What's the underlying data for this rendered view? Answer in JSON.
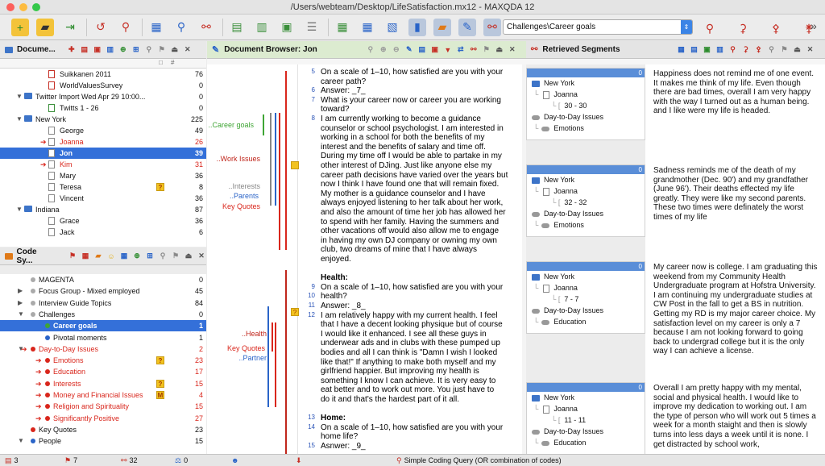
{
  "window": {
    "title": "/Users/webteam/Desktop/LifeSatisfaction.mx12 - MAXQDA 12"
  },
  "toolbar": {
    "code_selector": "Challenges\\Career goals",
    "more": "»"
  },
  "doc_system": {
    "title": "Docume...",
    "col_icons": [
      "□",
      "#"
    ],
    "rows": [
      {
        "label": "Suikkanen 2011",
        "num": "76",
        "type": "pdf",
        "indent": 60
      },
      {
        "label": "WorldValuesSurvey",
        "num": "0",
        "type": "pdf",
        "indent": 60
      },
      {
        "label": "Twitter Import Wed Apr 29 10:00...",
        "num": "0",
        "type": "folder",
        "indent": 30
      },
      {
        "label": "Twitts 1 - 26",
        "num": "0",
        "type": "table",
        "indent": 60
      },
      {
        "label": "New York",
        "num": "225",
        "type": "folder",
        "indent": 30
      },
      {
        "label": "George",
        "num": "49",
        "type": "doc",
        "indent": 60
      },
      {
        "label": "Joanna",
        "num": "26",
        "type": "doc",
        "indent": 60,
        "red": true
      },
      {
        "label": "Jon",
        "num": "39",
        "type": "doc",
        "indent": 60,
        "sel": true
      },
      {
        "label": "Kim",
        "num": "31",
        "type": "doc",
        "indent": 60,
        "red": true
      },
      {
        "label": "Mary",
        "num": "36",
        "type": "doc",
        "indent": 60
      },
      {
        "label": "Teresa",
        "num": "8",
        "type": "doc",
        "indent": 60,
        "memo": "?"
      },
      {
        "label": "Vincent",
        "num": "36",
        "type": "doc",
        "indent": 60
      },
      {
        "label": "Indiana",
        "num": "87",
        "type": "folder",
        "indent": 30
      },
      {
        "label": "Grace",
        "num": "36",
        "type": "doc",
        "indent": 60
      },
      {
        "label": "Jack",
        "num": "6",
        "type": "doc",
        "indent": 60
      }
    ]
  },
  "code_system": {
    "title": "Code Sy...",
    "rows": [
      {
        "label": "MAGENTA",
        "num": "0",
        "color": "#aaaaaa",
        "indent": 38
      },
      {
        "label": "Focus Group - Mixed employed",
        "num": "45",
        "color": "#aaaaaa",
        "indent": 38,
        "tri": "▶"
      },
      {
        "label": "Interview Guide Topics",
        "num": "84",
        "color": "#aaaaaa",
        "indent": 38,
        "tri": "▶"
      },
      {
        "label": "Challenges",
        "num": "0",
        "color": "#aaaaaa",
        "indent": 38,
        "tri": "▼"
      },
      {
        "label": "Career goals",
        "num": "1",
        "color": "#3fa535",
        "indent": 56,
        "sel": true
      },
      {
        "label": "Pivotal moments",
        "num": "1",
        "color": "#2a64c8",
        "indent": 56
      },
      {
        "label": "Day-to-Day Issues",
        "num": "2",
        "color": "#d9261c",
        "indent": 38,
        "tri": "▼",
        "red": true
      },
      {
        "label": "Emotions",
        "num": "23",
        "color": "#d9261c",
        "indent": 56,
        "red": true,
        "memo": "?"
      },
      {
        "label": "Education",
        "num": "17",
        "color": "#d9261c",
        "indent": 56,
        "red": true
      },
      {
        "label": "Interests",
        "num": "15",
        "color": "#d9261c",
        "indent": 56,
        "red": true,
        "memo": "?"
      },
      {
        "label": "Money and Financial Issues",
        "num": "4",
        "color": "#d9261c",
        "indent": 56,
        "red": true,
        "memo": "M"
      },
      {
        "label": "Religion and Spirituality",
        "num": "15",
        "color": "#d9261c",
        "indent": 56,
        "red": true
      },
      {
        "label": "Significantly Positive",
        "num": "27",
        "color": "#d9261c",
        "indent": 56,
        "red": true
      },
      {
        "label": "Key Quotes",
        "num": "23",
        "color": "#d9261c",
        "indent": 38
      },
      {
        "label": "People",
        "num": "15",
        "color": "#2a64c8",
        "indent": 38,
        "tri": "▼"
      }
    ]
  },
  "doc_browser": {
    "title": "Document Browser: Jon",
    "code_labels": [
      {
        "text": "..Career goals",
        "color": "#3fa535"
      },
      {
        "text": "..Work Issues",
        "color": "#c0261c"
      },
      {
        "text": "..Interests",
        "color": "#888888"
      },
      {
        "text": "..Parents",
        "color": "#2a64c8"
      },
      {
        "text": "Key Quotes",
        "color": "#d9261c"
      },
      {
        "text": "..Health",
        "color": "#c0261c"
      },
      {
        "text": "Key Quotes",
        "color": "#d9261c"
      },
      {
        "text": "..Partner",
        "color": "#2a64c8"
      }
    ],
    "line_numbers": [
      "5",
      "6",
      "7",
      "8",
      "9",
      "10",
      "11",
      "12",
      "13",
      "14",
      "15"
    ],
    "lines": [
      "On a scale of 1–10, how satisfied are you with your",
      "      career path?",
      "Answer: _7_",
      "What is your career now or career you are working",
      "      toward?",
      "I am currently working to become a guidance",
      "counselor or school psychologist.  I am interested in",
      "working in a school for both the benefits of my",
      "interest and the benefits of salary and time off.",
      "During my time off I would be able to partake in my",
      "other interest of DJing.   Just like anyone else my",
      "career path decisions have varied over the years but",
      "now I think I have found one that will remain fixed.",
      "My mother is a guidance counselor and I have",
      "always enjoyed listening to her talk about her work,",
      "and also the amount of time her job has allowed her",
      "to spend with her family.  Having the summers and",
      "other vacations off would also allow me to engage",
      "in having my own DJ company or owning my own",
      "club, two dreams of mine that I have always",
      "enjoyed.",
      "",
      "Health:",
      "On a scale of 1–10, how satisfied are you with your",
      "      health?",
      "Answer: _8_",
      "I am relatively happy with my current health.  I feel",
      "that I have a decent looking physique but of course",
      "I would like it enhanced.  I see all these guys in",
      "underwear ads and in clubs with these pumped up",
      "bodies and all I can think is \"Damn I wish I looked",
      "like that!\"  If anything to make both myself and my",
      "girlfriend happier.  But improving my health is",
      "something I know I can achieve.  It is very easy to",
      "eat better and to work out more.  You just have to",
      "do it and that's the hardest part of it all.",
      "",
      "Home:",
      "On a scale of 1–10, how satisfied are you with your",
      "      home life?",
      "Asnwer: _9_"
    ]
  },
  "retrieved": {
    "title": "Retrieved Segments",
    "segments": [
      {
        "badge": "0",
        "folder": "New York",
        "doc": "Joanna",
        "range": "30 - 30",
        "codefolder": "Day-to-Day Issues",
        "code": "Emotions",
        "text": "Happiness does not remind me of one event. It makes me think of my life.  Even though there are bad times, overall I am very happy with the way I turned out as a human being. and I like were my life is headed."
      },
      {
        "badge": "0",
        "folder": "New York",
        "doc": "Joanna",
        "range": "32 - 32",
        "codefolder": "Day-to-Day Issues",
        "code": "Emotions",
        "text": "Sadness reminds me of the death of my grandmother (Dec. 90') and my grandfather (June 96').  Their deaths effected my life greatly. They were like my second parents. These two times were definately the worst times of my life"
      },
      {
        "badge": "0",
        "folder": "New York",
        "doc": "Joanna",
        "range": "7 - 7",
        "codefolder": "Day-to-Day Issues",
        "code": "Education",
        "text": "My career now is college. I am graduating this weekend from my Community Health Undergraduate program at Hofstra University.  I am continuing my undergraduate studies at CW Post in the fall to get a BS in nutrition.  Getting my RD is my major career choice.  My satisfaction level on my career is only a 7 because I am not looking forward to going back to undergrad college but it is the only way I can achieve a license."
      },
      {
        "badge": "0",
        "folder": "New York",
        "doc": "Joanna",
        "range": "11 - 11",
        "codefolder": "Day-to-Day Issues",
        "code": "Education",
        "text": "Overall I am pretty happy with my mental, social and physical health.  I would like to improve my dedication to working out.  I am the type of person who will work out 5 times a week for a month staight and then is slowly turns into less days a week until it is none.  I get distracted by school work,"
      }
    ]
  },
  "status": {
    "docs": "3",
    "codes": "7",
    "segments": "32",
    "weight": "0",
    "query": "Simple Coding Query (OR combination of codes)"
  },
  "colors": {
    "accent": "#3470d9",
    "red": "#d9261c",
    "green": "#3fa535",
    "blue": "#2a64c8",
    "yellow": "#f2c21f"
  }
}
